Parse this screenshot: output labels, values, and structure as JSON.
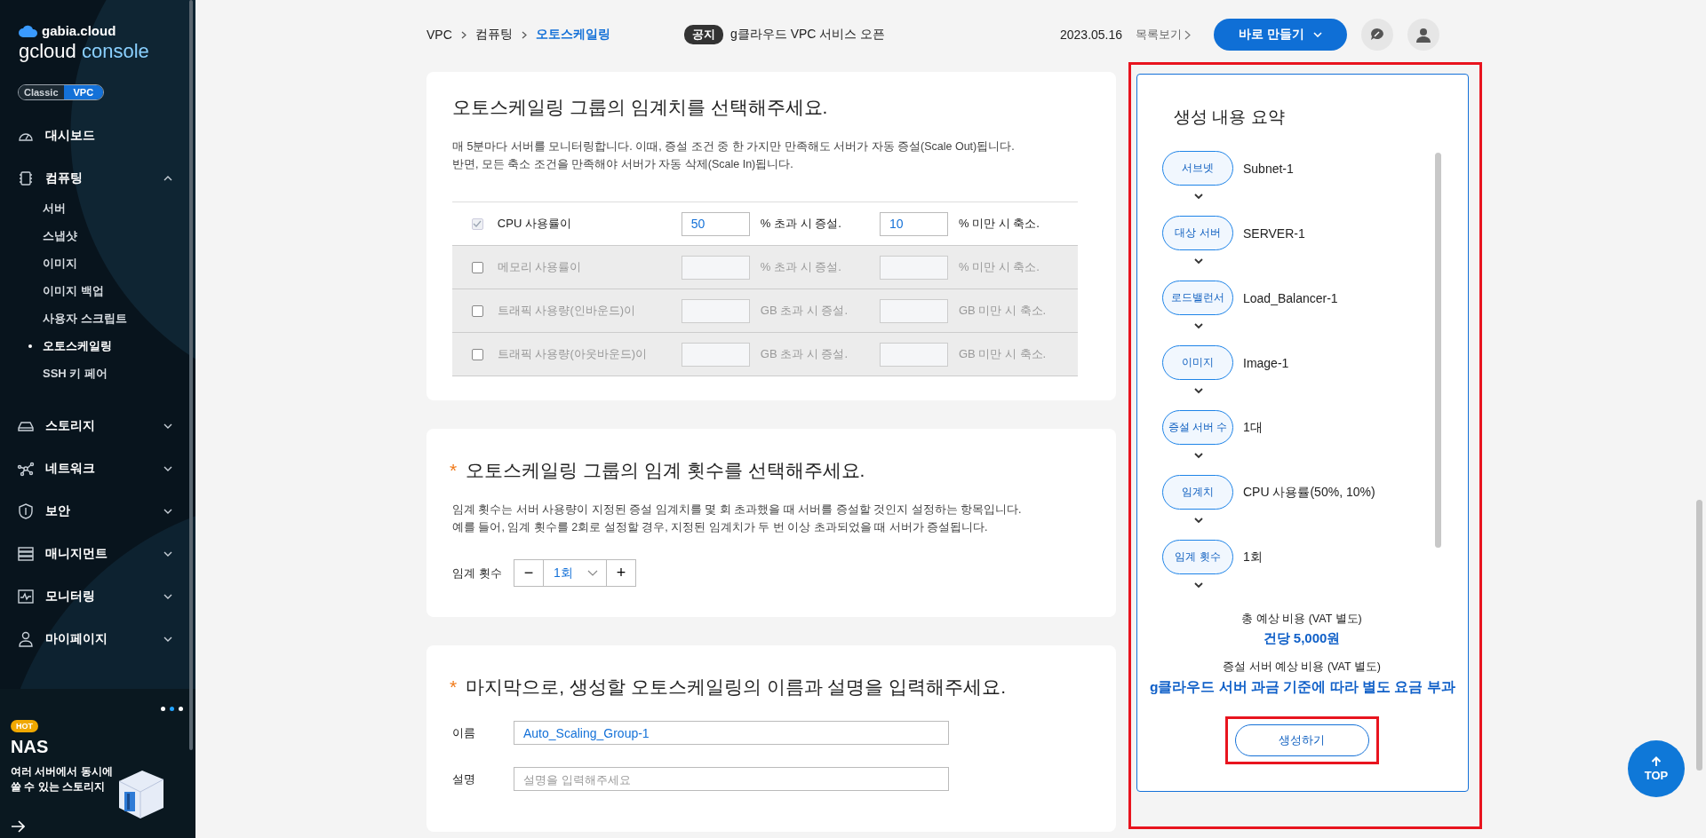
{
  "brand": {
    "company": "gabia.cloud",
    "product": "gcloud",
    "suffix": "console"
  },
  "mode_toggle": [
    {
      "label": "Classic",
      "selected": false
    },
    {
      "label": "VPC",
      "selected": true
    }
  ],
  "nav": [
    {
      "label": "대시보드",
      "kind": "gauge"
    },
    {
      "label": "컴퓨팅",
      "kind": "chip",
      "expanded": true,
      "children": [
        {
          "label": "서버",
          "selected": false
        },
        {
          "label": "스냅샷",
          "selected": false
        },
        {
          "label": "이미지",
          "selected": false
        },
        {
          "label": "이미지 백업",
          "selected": false
        },
        {
          "label": "사용자 스크립트",
          "selected": false
        },
        {
          "label": "오토스케일링",
          "selected": true
        },
        {
          "label": "SSH 키 페어",
          "selected": false
        }
      ]
    },
    {
      "label": "스토리지",
      "kind": "disk",
      "expanded": false
    },
    {
      "label": "네트워크",
      "kind": "network",
      "expanded": false
    },
    {
      "label": "보안",
      "kind": "shield",
      "expanded": false
    },
    {
      "label": "매니지먼트",
      "kind": "rack",
      "expanded": false
    },
    {
      "label": "모니터링",
      "kind": "pulse",
      "expanded": false
    },
    {
      "label": "마이페이지",
      "kind": "person",
      "expanded": false
    }
  ],
  "promo": {
    "badge": "HOT",
    "title": "NAS",
    "lines": [
      "여러 서버에서 동시에",
      "쓸 수 있는 스토리지"
    ],
    "dots": [
      {
        "selected": false
      },
      {
        "selected": true
      },
      {
        "selected": false
      }
    ]
  },
  "breadcrumb": [
    {
      "label": "VPC",
      "selected": false
    },
    {
      "label": "컴퓨팅",
      "selected": false
    },
    {
      "label": "오토스케일링",
      "selected": true
    }
  ],
  "notice": {
    "badge": "공지",
    "text": "g클라우드 VPC 서비스 오픈",
    "date": "2023.05.16",
    "more": "목록보기"
  },
  "create_menu": "바로 만들기",
  "threshold": {
    "title": "오토스케일링 그룹의 임계치를 선택해주세요.",
    "description": [
      "매 5분마다 서버를 모니터링합니다. 이때, 증설 조건 중 한 가지만 만족해도 서버가 자동 증설(Scale Out)됩니다.",
      "반면, 모든 축소 조건을 만족해야 서버가 자동 삭제(Scale In)됩니다."
    ],
    "metrics": [
      {
        "checked": true,
        "name": "CPU 사용률이",
        "up_value": "50",
        "up_text": "% 초과 시 증설.",
        "down_value": "10",
        "down_text": "% 미만 시 축소."
      },
      {
        "checked": false,
        "name": "메모리 사용률이",
        "up_text": "% 초과 시 증설.",
        "down_text": "% 미만 시 축소."
      },
      {
        "checked": false,
        "name": "트래픽 사용량(인바운드)이",
        "up_text": "GB 초과 시 증설.",
        "down_text": "GB 미만 시 축소."
      },
      {
        "checked": false,
        "name": "트래픽 사용량(아웃바운드)이",
        "up_text": "GB 초과 시 증설.",
        "down_text": "GB 미만 시 축소."
      }
    ]
  },
  "count": {
    "mark": "*",
    "title": "오토스케일링 그룹의 임계 횟수를 선택해주세요.",
    "description": [
      "임계 횟수는 서버 사용량이 지정된 증설 임계치를 몇 회 초과했을 때 서버를 증설할 것인지 설정하는 항목입니다.",
      "예를 들어, 임계 횟수를 2회로 설정할 경우, 지정된 임계치가 두 번 이상 초과되었을 때 서버가 증설됩니다."
    ],
    "label": "임계 횟수",
    "minus": "−",
    "value": "1회",
    "plus": "+"
  },
  "naming": {
    "mark": "*",
    "title": "마지막으로, 생성할 오토스케일링의 이름과 설명을 입력해주세요.",
    "fields": [
      {
        "label": "이름",
        "value": "Auto_Scaling_Group-1"
      },
      {
        "label": "설명",
        "placeholder": "설명을 입력해주세요"
      }
    ]
  },
  "summary": {
    "highlighted": true,
    "title": "생성 내용 요약",
    "steps": [
      {
        "tag": "서브넷",
        "value": "Subnet-1"
      },
      {
        "tag": "대상 서버",
        "value": "SERVER-1"
      },
      {
        "tag": "로드밸런서",
        "value": "Load_Balancer-1"
      },
      {
        "tag": "이미지",
        "value": "Image-1"
      },
      {
        "tag": "증설 서버 수",
        "value": "1대"
      },
      {
        "tag": "임계치",
        "value": "CPU 사용률(50%, 10%)"
      },
      {
        "tag": "임계 횟수",
        "value": "1회"
      }
    ],
    "cost_label": "총 예상 비용 (VAT 별도)",
    "cost": "건당 5,000원",
    "extra_label": "증설 서버 예상 비용 (VAT 별도)",
    "extra": "g클라우드 서버 과금 기준에 따라 별도 요금 부과",
    "button": "생성하기",
    "button_highlighted": true
  },
  "top_button": "TOP"
}
